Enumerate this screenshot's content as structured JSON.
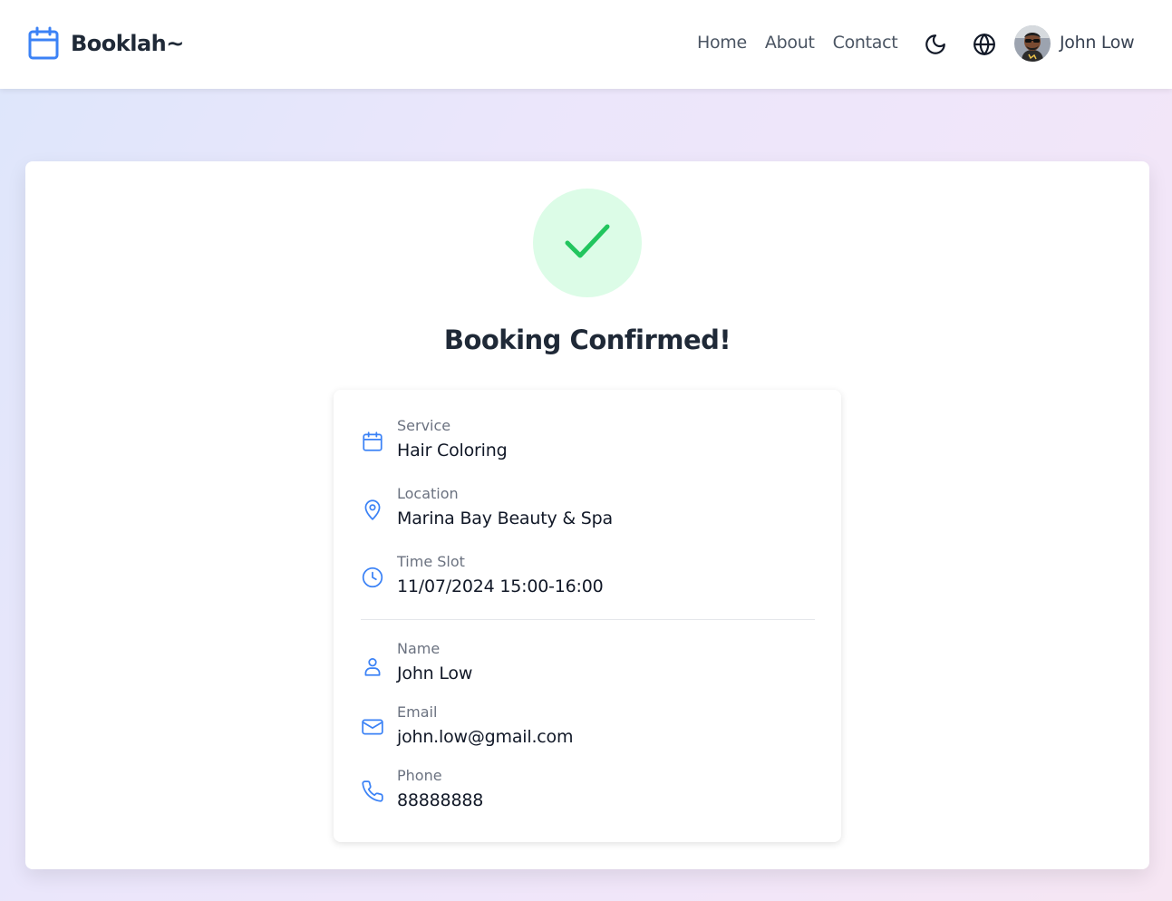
{
  "app": {
    "brand": "Booklah~",
    "accent_color": "#3b82f6",
    "success_color": "#22c55e"
  },
  "nav": {
    "links": [
      "Home",
      "About",
      "Contact"
    ],
    "theme_icon": "moon-icon",
    "language_icon": "globe-icon",
    "user_name": "John Low"
  },
  "confirmation": {
    "icon": "check-icon",
    "title": "Booking Confirmed!",
    "booking": {
      "service_label": "Service",
      "service_value": "Hair Coloring",
      "location_label": "Location",
      "location_value": "Marina Bay Beauty & Spa",
      "time_label": "Time Slot",
      "time_value": "11/07/2024 15:00-16:00"
    },
    "customer": {
      "name_label": "Name",
      "name_value": "John Low",
      "email_label": "Email",
      "email_value": "john.low@gmail.com",
      "phone_label": "Phone",
      "phone_value": "88888888"
    }
  }
}
